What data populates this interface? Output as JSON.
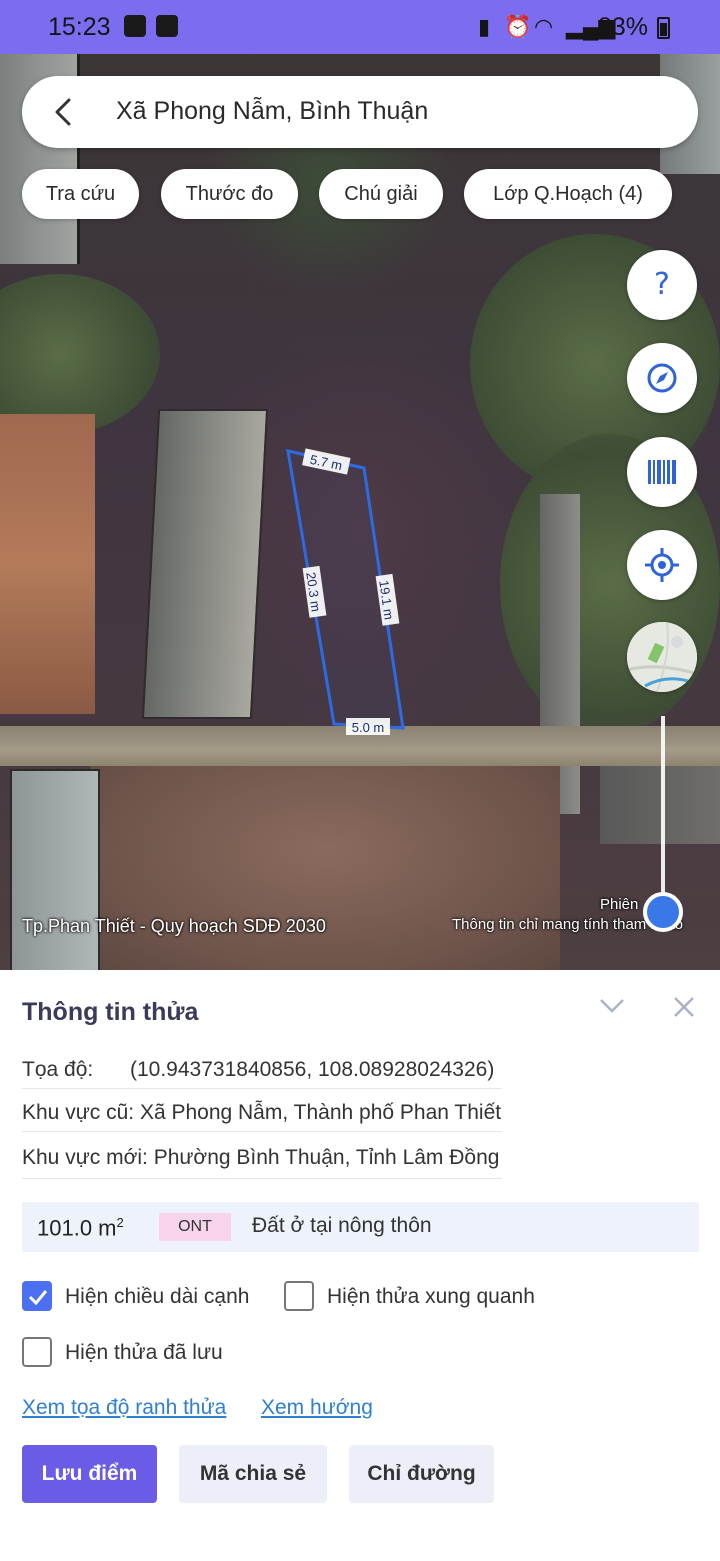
{
  "status_bar": {
    "time": "15:23",
    "battery": "83%"
  },
  "search": {
    "title": "Xã Phong Nẫm, Bình Thuận"
  },
  "chips": [
    {
      "label": "Tra cứu"
    },
    {
      "label": "Thước đo"
    },
    {
      "label": "Chú giải"
    },
    {
      "label": "Lớp Q.Hoạch (4)"
    }
  ],
  "map": {
    "parcel_edges": {
      "top": "5.7 m",
      "left": "20.3 m",
      "right": "19.1 m",
      "bottom": "5.0 m"
    },
    "caption_left": "Tp.Phan Thiết - Quy hoạch SDĐ 2030",
    "caption_right": "Thông tin chỉ mang tính tham khảo",
    "version": "Phiên",
    "help_label": "?",
    "accent": "#2f63d8"
  },
  "panel": {
    "title": "Thông tin thửa",
    "coord_label": "Tọa độ:",
    "coord_value": "(10.943731840856, 108.08928024326)",
    "old_area": "Khu vực cũ: Xã Phong Nẫm, Thành phố Phan Thiết",
    "new_area": "Khu vực mới: Phường Bình Thuận, Tỉnh Lâm Đồng",
    "area": "101.0 m",
    "area_unit_sup": "2",
    "land_code": "ONT",
    "land_use": "Đất ở tại nông thôn",
    "checkboxes": [
      {
        "label": "Hiện chiều dài cạnh",
        "checked": true
      },
      {
        "label": "Hiện thửa xung quanh",
        "checked": false
      },
      {
        "label": "Hiện thửa đã lưu",
        "checked": false
      }
    ],
    "links": {
      "view_coords": "Xem tọa độ ranh thửa",
      "view_direction": "Xem hướng"
    },
    "buttons": {
      "save": "Lưu điểm",
      "share": "Mã chia sẻ",
      "directions": "Chỉ đường"
    },
    "brand_color": "#6b5ce7"
  }
}
